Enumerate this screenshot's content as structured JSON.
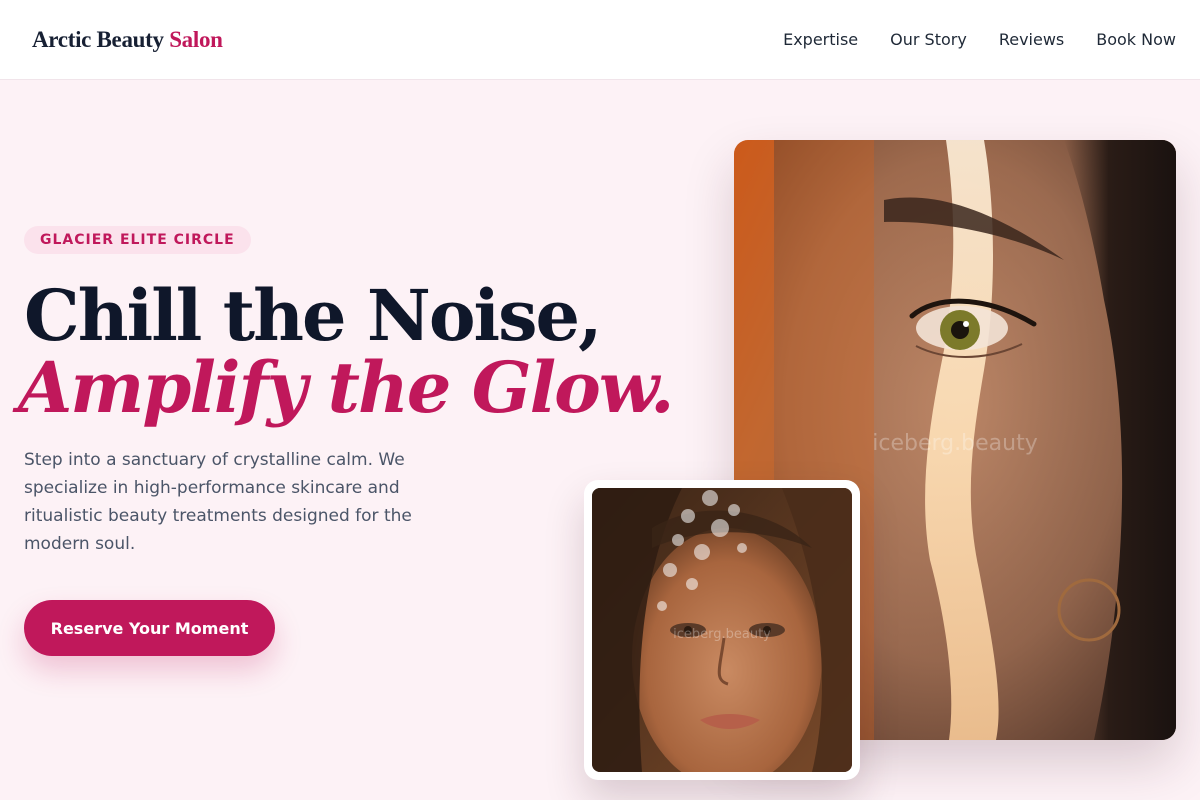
{
  "header": {
    "brand_main": "Arctic Beauty",
    "brand_accent": "Salon",
    "nav": [
      {
        "label": "Expertise"
      },
      {
        "label": "Our Story"
      },
      {
        "label": "Reviews"
      },
      {
        "label": "Book Now"
      }
    ]
  },
  "hero": {
    "badge": "GLACIER ELITE CIRCLE",
    "headline_line1": "Chill the Noise,",
    "headline_line2": "Amplify the Glow.",
    "subtext": "Step into a sanctuary of crystalline calm. We specialize in high-performance skincare and ritualistic beauty treatments designed for the modern soul.",
    "cta_label": "Reserve Your Moment"
  },
  "images": {
    "main_watermark": "iceberg.beauty",
    "small_watermark": "iceberg.beauty"
  },
  "colors": {
    "accent": "#c0185b",
    "background": "#fdf2f6",
    "ink": "#0f172a"
  }
}
